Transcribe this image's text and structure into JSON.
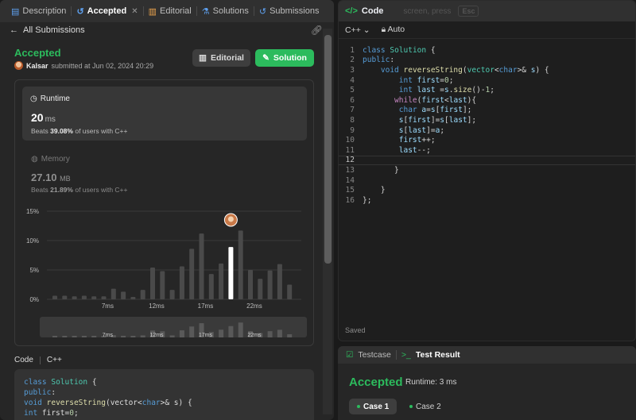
{
  "tabs": [
    {
      "label": "Description",
      "icon": "document-icon"
    },
    {
      "label": "Accepted",
      "icon": "history-icon",
      "close": "✕"
    },
    {
      "label": "Editorial",
      "icon": "book-icon"
    },
    {
      "label": "Solutions",
      "icon": "flask-icon"
    },
    {
      "label": "Submissions",
      "icon": "history-icon"
    }
  ],
  "back_label": "All Submissions",
  "submission": {
    "status": "Accepted",
    "user": "Kalsar",
    "submitted_text": "submitted at Jun 02, 2024 20:29"
  },
  "buttons": {
    "editorial": "Editorial",
    "solution": "Solution"
  },
  "runtime": {
    "title": "Runtime",
    "value": "20",
    "unit": "ms",
    "beats_prefix": "Beats",
    "beats_pct": "39.08%",
    "beats_suffix": "of users with C++"
  },
  "memory": {
    "title": "Memory",
    "value": "27.10",
    "unit": "MB",
    "beats_prefix": "Beats",
    "beats_pct": "21.89%",
    "beats_suffix": "of users with C++"
  },
  "chart_data": {
    "type": "bar",
    "ytick_labels": [
      "15%",
      "10%",
      "5%",
      "0%"
    ],
    "xtick_labels": [
      "7ms",
      "12ms",
      "17ms",
      "22ms"
    ],
    "x": [
      2,
      3,
      4,
      5,
      6,
      7,
      8,
      9,
      10,
      11,
      12,
      13,
      14,
      15,
      16,
      17,
      18,
      19,
      20,
      21,
      22,
      23,
      24
    ],
    "values": [
      0.6,
      0.6,
      0.5,
      0.6,
      0.5,
      0.5,
      1.8,
      1.3,
      0.4,
      1.6,
      5.4,
      4.8,
      1.6,
      5.6,
      8.6,
      11.2,
      4.3,
      6.1,
      8.9,
      11.7,
      5.0,
      3.5,
      4.9,
      6.0,
      2.5
    ],
    "highlight_x": 20,
    "ylim": [
      0,
      15
    ],
    "grid": true,
    "mini_xtick_labels": [
      "7ms",
      "12ms",
      "17ms",
      "22ms"
    ]
  },
  "code_section": {
    "label": "Code",
    "lang": "C++"
  },
  "left_code_lines": [
    "class Solution {",
    "public:",
    "    void reverseString(vector<char>& s) {",
    "        int first=0;"
  ],
  "editor": {
    "title": "Code",
    "ghost_text": "screen, press",
    "ghost_key": "Esc",
    "language": "C++",
    "mode": "Auto",
    "current_line": 12,
    "lines": [
      "class Solution {",
      "public:",
      "    void reverseString(vector<char>& s) {",
      "        int first=0;",
      "        int last =s.size()-1;",
      "       while(first<last){",
      "        char a=s[first];",
      "        s[first]=s[last];",
      "        s[last]=a;",
      "        first++;",
      "        last--;",
      "",
      "       }",
      "",
      "    }",
      "};"
    ],
    "saved": "Saved"
  },
  "result": {
    "tab_testcase": "Testcase",
    "tab_result": "Test Result",
    "status": "Accepted",
    "runtime": "Runtime: 3 ms",
    "cases": [
      "Case 1",
      "Case 2"
    ]
  }
}
